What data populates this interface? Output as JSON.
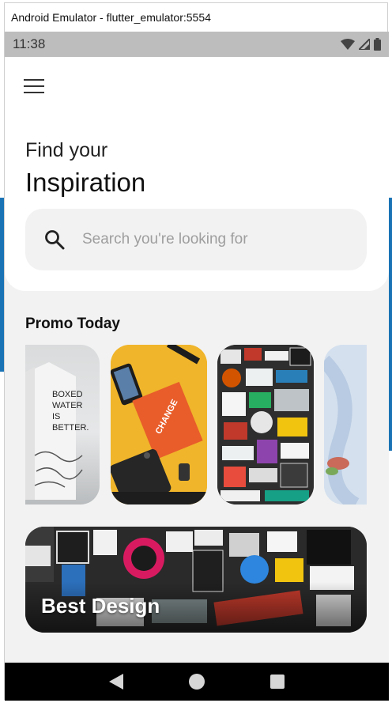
{
  "window": {
    "title": "Android Emulator - flutter_emulator:5554"
  },
  "status_bar": {
    "time": "11:38"
  },
  "header": {
    "find_text": "Find your",
    "inspiration_text": "Inspiration"
  },
  "search": {
    "placeholder": "Search you're looking for"
  },
  "promo": {
    "title": "Promo Today",
    "cards": [
      {
        "label": "boxed-water-carton"
      },
      {
        "label": "change-by-design-book"
      },
      {
        "label": "sticker-wall"
      },
      {
        "label": "hand-painting"
      }
    ]
  },
  "banner": {
    "label": "Best Design"
  },
  "colors": {
    "status_bar": "#bdbdbd",
    "device_bg": "#f2f2f2",
    "nav_bar": "#000000",
    "background_accent": "#1a73b5"
  }
}
